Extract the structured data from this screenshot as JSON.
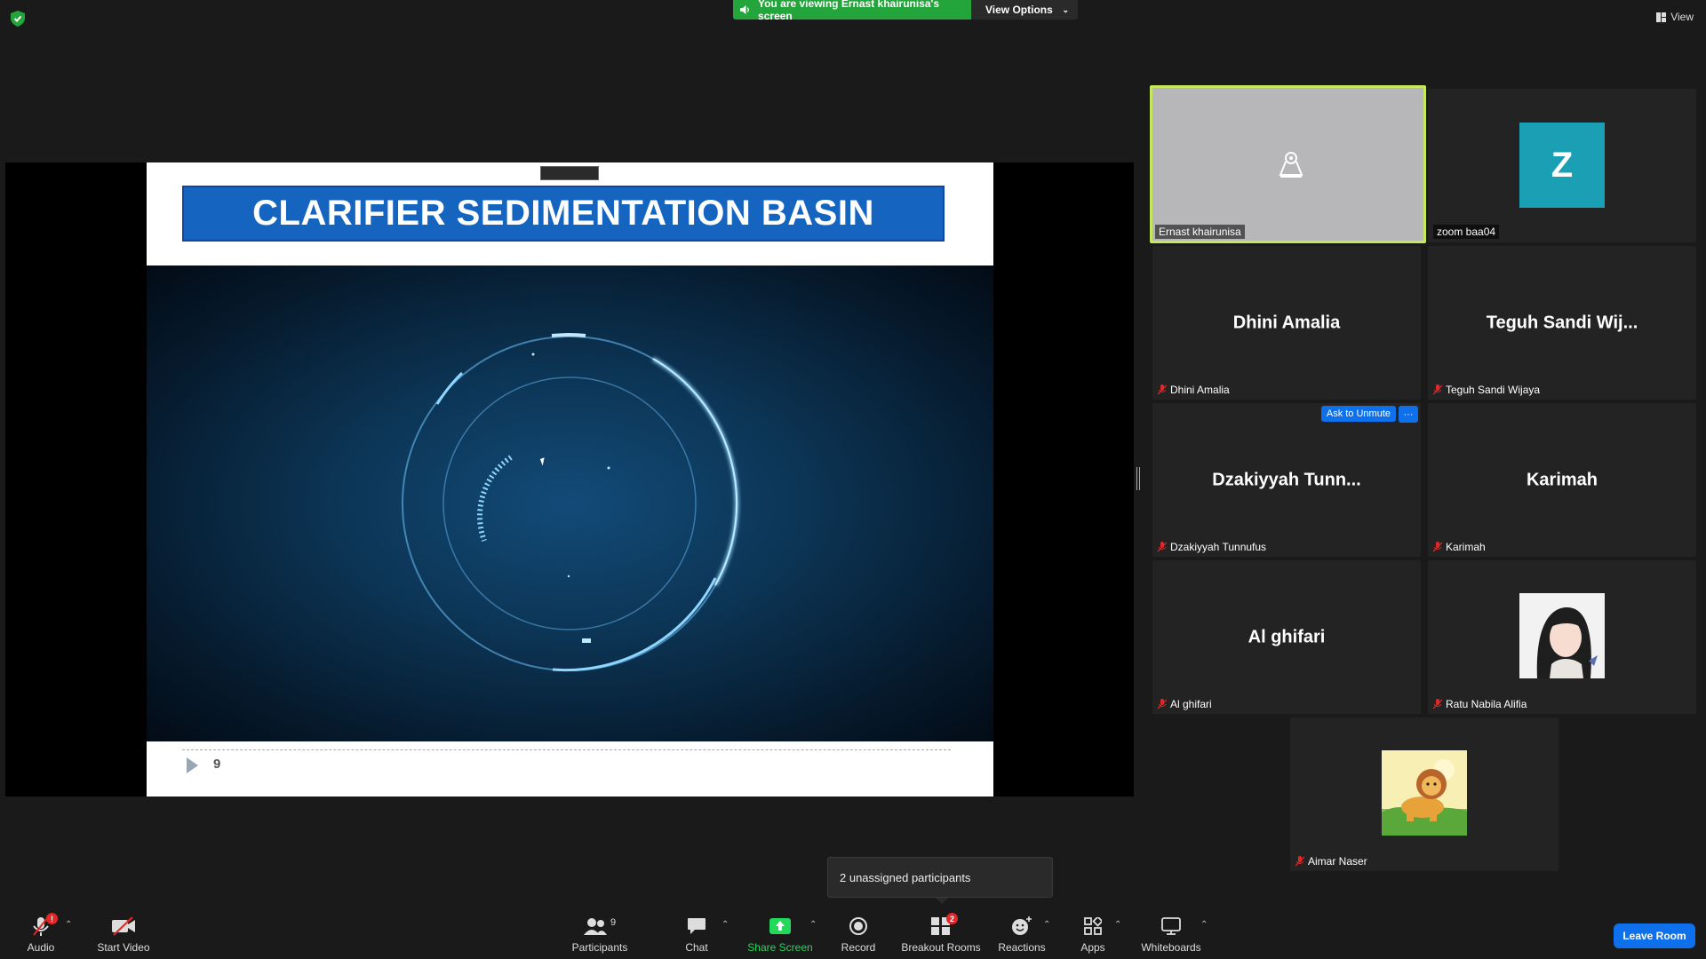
{
  "top_bar": {
    "viewing_banner": "You are viewing Ernast khairunisa's screen",
    "view_options": "View Options",
    "view": "View"
  },
  "shared_screen": {
    "slide_title": "CLARIFIER SEDIMENTATION BASIN",
    "slide_number": "9"
  },
  "gallery": {
    "tiles": [
      {
        "label": "Ernast khairunisa",
        "active": true
      },
      {
        "label": "zoom baa04",
        "avatar_letter": "Z"
      },
      {
        "display_name": "Dhini Amalia",
        "label": "Dhini Amalia"
      },
      {
        "display_name": "Teguh Sandi Wij...",
        "label": "Teguh Sandi Wijaya"
      },
      {
        "display_name": "Dzakiyyah Tunn...",
        "label": "Dzakiyyah Tunnufus",
        "ask_to_unmute": "Ask to Unmute",
        "more": "···"
      },
      {
        "display_name": "Karimah",
        "label": "Karimah"
      },
      {
        "display_name": "Al ghifari",
        "label": "Al ghifari"
      },
      {
        "label": "Ratu Nabila Alifia"
      },
      {
        "label": "Aimar Naser"
      }
    ]
  },
  "toast": "2 unassigned participants",
  "toolbar": {
    "audio": "Audio",
    "audio_badge": "!",
    "start_video": "Start Video",
    "participants": "Participants",
    "participants_count": "9",
    "chat": "Chat",
    "share_screen": "Share Screen",
    "record": "Record",
    "breakout_rooms": "Breakout Rooms",
    "breakout_badge": "2",
    "reactions": "Reactions",
    "apps": "Apps",
    "whiteboards": "Whiteboards",
    "leave_room": "Leave Room"
  },
  "colors": {
    "banner_green": "#23a53b",
    "accent_blue": "#0e71eb",
    "active_speaker": "#c5e85c",
    "share_green": "#23d95b",
    "mute_red": "#e02828"
  }
}
